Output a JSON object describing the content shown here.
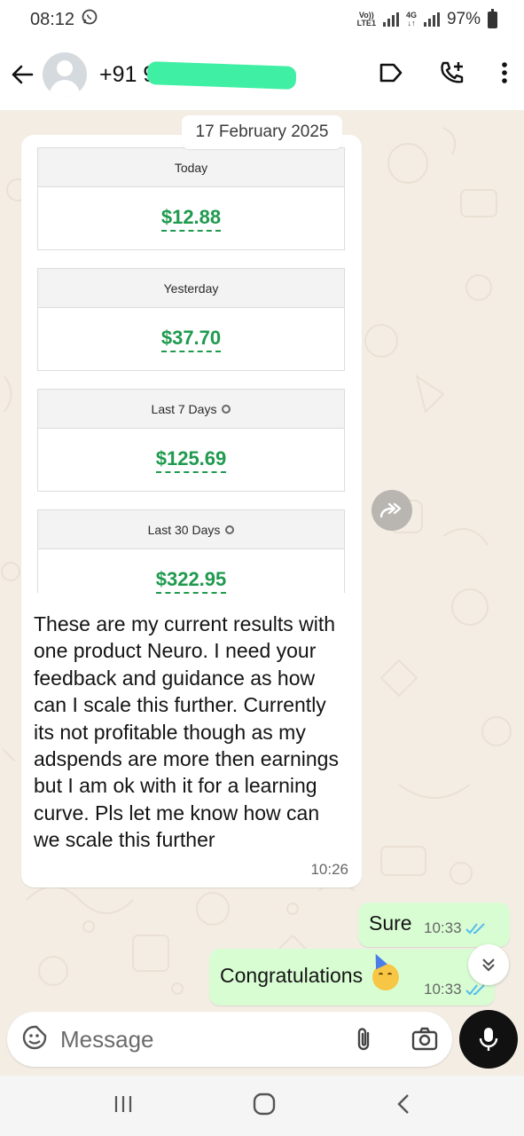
{
  "status_bar": {
    "time": "08:12",
    "network_top": "Vo))",
    "network_bottom": "LTE1",
    "gen_top": "4G",
    "gen_bottom": "↓↑",
    "battery": "97%"
  },
  "header": {
    "contact_name": "+91 9",
    "icons": [
      "back-arrow-icon",
      "label-icon",
      "call-add-icon",
      "more-icon"
    ]
  },
  "chat": {
    "date_chip": "17 February 2025",
    "incoming": {
      "cards": [
        {
          "label": "Today",
          "value": "$12.88",
          "info": false
        },
        {
          "label": "Yesterday",
          "value": "$37.70",
          "info": false
        },
        {
          "label": "Last 7 Days",
          "value": "$125.69",
          "info": true
        },
        {
          "label": "Last 30 Days",
          "value": "$322.95",
          "info": true
        }
      ],
      "text": "These are my current results with one product Neuro. I need your feedback and guidance as how can I scale this further. Currently its not profitable though as my adspends are more then earnings but I am ok with it for a learning curve. Pls let me know how can we scale this further",
      "time": "10:26"
    },
    "outgoing": [
      {
        "text": "Sure",
        "time": "10:33"
      },
      {
        "text": "Congratulations",
        "time": "10:33"
      }
    ]
  },
  "composer": {
    "placeholder": "Message"
  },
  "colors": {
    "bubble_out": "#d9fdd3",
    "wallpaper": "#f3ede4",
    "money_green": "#1f9a4e",
    "redaction": "#3fefa4",
    "read_tick": "#53bdeb"
  }
}
